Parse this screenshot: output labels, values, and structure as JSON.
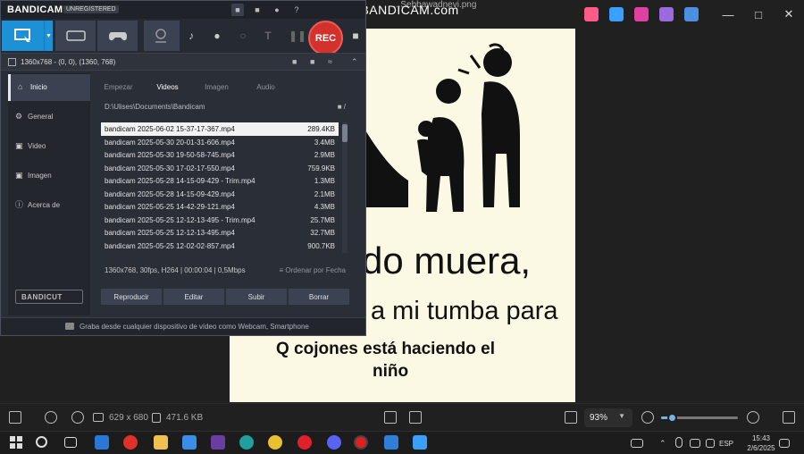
{
  "viewer": {
    "title": "...Sebbawadnevi.png",
    "bottom": {
      "dims": "629 x 680",
      "size": "471.6 KB",
      "zoom": "93%",
      "zoom_fraction": 0.14
    }
  },
  "meme": {
    "line1": "do muera,",
    "line2": "a mi tumba para",
    "line3": "Q cojones está haciendo el",
    "line4": "niño"
  },
  "watermark": "www.BANDICAM.com",
  "bandicam": {
    "logo": "BANDICAM",
    "unregistered": "UNREGISTERED",
    "rec_label": "REC",
    "resolution": "1360x768 - (0, 0), (1360, 768)",
    "sidebar": [
      {
        "label": "Inicio"
      },
      {
        "label": "General"
      },
      {
        "label": "Video"
      },
      {
        "label": "Imagen"
      },
      {
        "label": "Acerca de"
      }
    ],
    "bandicut": "BANDICUT",
    "tabs": [
      "Empezar",
      "Videos",
      "Imagen",
      "Audio"
    ],
    "path": "D:\\Ulises\\Documents\\Bandicam",
    "files": [
      {
        "name": "bandicam 2025-06-02 15-37-17-367.mp4",
        "size": "289.4KB"
      },
      {
        "name": "bandicam 2025-05-30 20-01-31-606.mp4",
        "size": "3.4MB"
      },
      {
        "name": "bandicam 2025-05-30 19-50-58-745.mp4",
        "size": "2.9MB"
      },
      {
        "name": "bandicam 2025-05-30 17-02-17-550.mp4",
        "size": "759.9KB"
      },
      {
        "name": "bandicam 2025-05-28 14-15-09-429 - Trim.mp4",
        "size": "1.3MB"
      },
      {
        "name": "bandicam 2025-05-28 14-15-09-429.mp4",
        "size": "2.1MB"
      },
      {
        "name": "bandicam 2025-05-25 14-42-29-121.mp4",
        "size": "4.3MB"
      },
      {
        "name": "bandicam 2025-05-25 12-12-13-495 - Trim.mp4",
        "size": "25.7MB"
      },
      {
        "name": "bandicam 2025-05-25 12-12-13-495.mp4",
        "size": "32.7MB"
      },
      {
        "name": "bandicam 2025-05-25 12-02-02-857.mp4",
        "size": "900.7KB"
      }
    ],
    "info": "1360x768, 30fps, H264 | 00:00:04 | 0,5Mbps",
    "sort": "Ordenar por Fecha",
    "actions": [
      "Reproducir",
      "Editar",
      "Subir",
      "Borrar"
    ],
    "footer": "Graba desde cualquier dispositivo de vídeo como Webcam, Smartphone"
  },
  "taskbar": {
    "lang": "ESP",
    "time": "15:43",
    "date": "2/6/2025"
  }
}
